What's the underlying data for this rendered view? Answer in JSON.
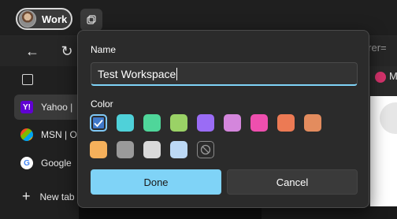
{
  "titlebar": {
    "profile_label": "Work"
  },
  "toolbar": {
    "address_fragment": "ferrer="
  },
  "sidebar": {
    "tabs": [
      {
        "label": "Yahoo |",
        "favicon": "Y!",
        "color": "#6001d2"
      },
      {
        "label": "MSN | O",
        "favicon": "",
        "color": "#00a4ef"
      },
      {
        "label": "Google",
        "favicon": "G",
        "color": "#4285f4"
      }
    ],
    "new_tab_label": "New tab"
  },
  "right_area": {
    "fragment": "M"
  },
  "dialog": {
    "name_label": "Name",
    "name_value": "Test Workspace",
    "color_label": "Color",
    "colors": [
      "#3f78c9",
      "#4fd1d9",
      "#4fd69a",
      "#9ad266",
      "#9a6cf5",
      "#d486dc",
      "#ee4fae",
      "#ec7a54",
      "#e38c5e",
      "#f5b05b",
      "#9a9a9a",
      "#d9d9d9",
      "#bcd9f5"
    ],
    "selected_color_index": 0,
    "done_label": "Done",
    "cancel_label": "Cancel"
  }
}
